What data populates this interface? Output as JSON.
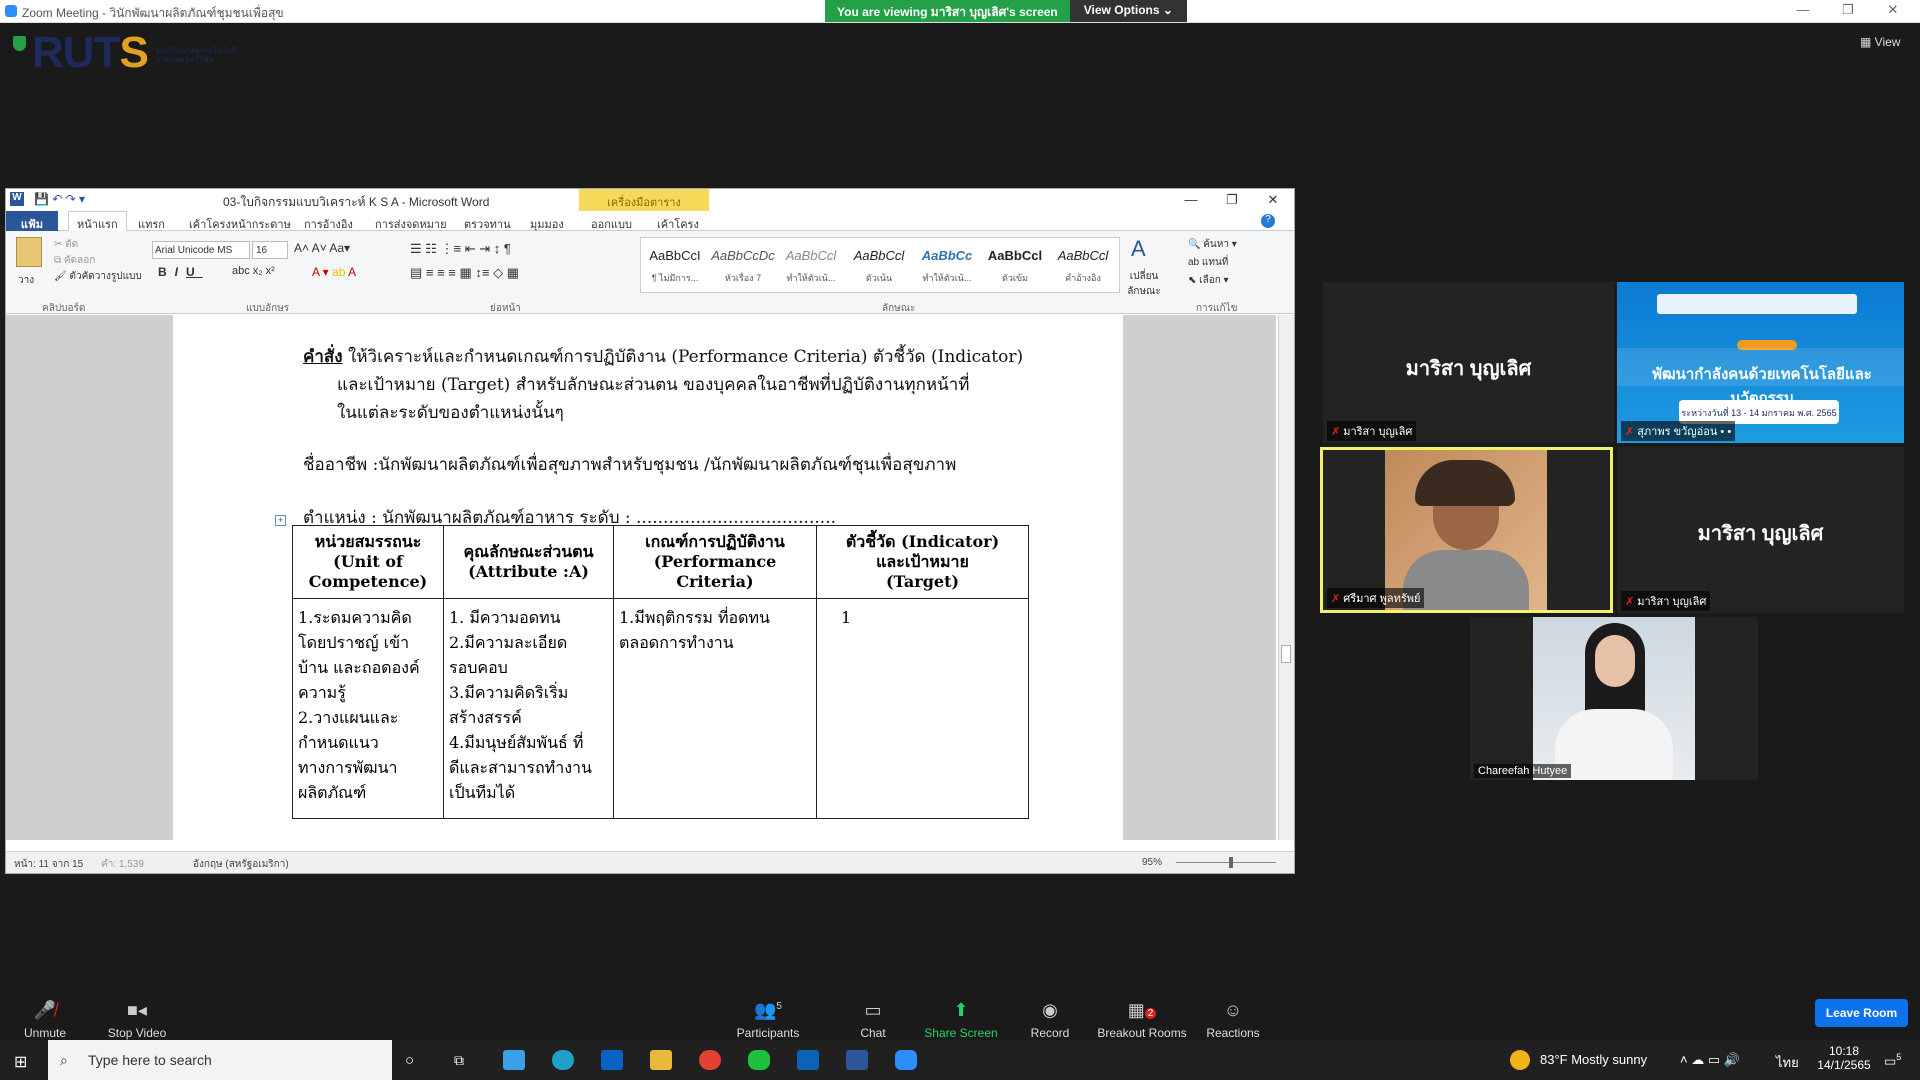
{
  "zoom": {
    "window_title": "Zoom Meeting - วินักพัฒนาผลิตภัณฑ์ชุมชนเพื่อสุข",
    "viewing_banner": "You are viewing มาริสา บุญเลิศ's screen",
    "view_options": "View Options ⌄",
    "view_label": "View",
    "logo_text": "RUTS",
    "controls": {
      "unmute": "Unmute",
      "stop_video": "Stop Video",
      "participants": "Participants",
      "participants_count": "5",
      "chat": "Chat",
      "share_screen": "Share Screen",
      "record": "Record",
      "breakout_rooms": "Breakout Rooms",
      "breakout_badge": "2",
      "reactions": "Reactions",
      "leave_room": "Leave Room"
    },
    "participants": [
      {
        "name": "มาริสา บุญเลิศ",
        "label": "มาริสา บุญเลิศ"
      },
      {
        "name": "",
        "label": "สุภาพร ขวัญอ่อน • •"
      },
      {
        "name": "",
        "label": "ศรีมาศ พูลทรัพย์"
      },
      {
        "name": "มาริสา บุญเลิศ",
        "label": "มาริสา บุญเลิศ"
      },
      {
        "name": "",
        "label": "Chareefah Hutyee"
      }
    ],
    "poster_title": "พัฒนากำลังคนด้วยเทคโนโลยีและนวัตกรรม",
    "poster_date": "ระหว่างวันที่ 13 - 14 มกราคม พ.ศ. 2565"
  },
  "word": {
    "title": "03-ใบกิจกรรมแบบวิเคราะห์ K S A  -  Microsoft Word",
    "contextual_tab": "เครื่องมือตาราง",
    "tabs": [
      "แฟ้ม",
      "หน้าแรก",
      "แทรก",
      "เค้าโครงหน้ากระดาษ",
      "การอ้างอิง",
      "การส่งจดหมาย",
      "ตรวจทาน",
      "มุมมอง",
      "ออกแบบ",
      "เค้าโครง"
    ],
    "font_name": "Arial Unicode MS",
    "font_size": "16",
    "clipboard": {
      "paste": "วาง",
      "cut": "ตัด",
      "copy": "คัดลอก",
      "format_painter": "ตัวคัดวางรูปแบบ"
    },
    "groups": [
      "คลิปบอร์ด",
      "แบบอักษร",
      "ย่อหน้า",
      "ลักษณะ",
      "การแก้ไข"
    ],
    "styles": [
      {
        "sample": "AaBbCcI",
        "name": "¶ ไม่มีการ..."
      },
      {
        "sample": "AaBbCcDc",
        "name": "หัวเรื่อง 7"
      },
      {
        "sample": "AaBbCcl",
        "name": "ทำให้ตัวเน้..."
      },
      {
        "sample": "AaBbCcl",
        "name": "ตัวเน้น"
      },
      {
        "sample": "AaBbCc",
        "name": "ทำให้ตัวเน้..."
      },
      {
        "sample": "AaBbCcl",
        "name": "ตัวเข้ม"
      },
      {
        "sample": "AaBbCcl",
        "name": "คำอ้างอิง"
      }
    ],
    "change_styles": "เปลี่ยน ลักษณะ",
    "editing": {
      "find": "ค้นหา",
      "replace": "แทนที่",
      "select": "เลือก"
    },
    "status": {
      "page": "หน้า: 11 จาก 15",
      "words": "คำ: 1,539",
      "language": "อังกฤษ (สหรัฐอเมริกา)",
      "zoom": "95%"
    },
    "doc": {
      "instruction_label": "คำสั่ง",
      "instruction_1": " ให้วิเคราะห์และกำหนดเกณฑ์การปฏิบัติงาน  (Performance Criteria) ตัวชี้วัด  (Indicator)",
      "instruction_2": "และเป้าหมาย (Target) สำหรับลักษณะส่วนตน ของบุคคลในอาชีพที่ปฏิบัติงานทุกหน้าที่",
      "instruction_3": "ในแต่ละระดับของตำแหน่งนั้นๆ",
      "occupation": "ชื่ออาชีพ :นักพัฒนาผลิตภัณฑ์เพื่อสุขภาพสำหรับชุมชน /นักพัฒนาผลิตภัณฑ์ชุนเพื่อสุขภาพ",
      "position": "ตำแหน่ง : นักพัฒนาผลิตภัณฑ์อาหาร     ระดับ : .....................................",
      "table": {
        "headers": [
          [
            "หน่วยสมรรถนะ",
            "(Unit of",
            "Competence)"
          ],
          [
            "คุณลักษณะส่วนตน",
            "(Attribute  :A)"
          ],
          [
            "เกณฑ์การปฏิบัติงาน",
            "(Performance  Criteria)"
          ],
          [
            "ตัวชี้วัด (Indicator)",
            "และเป้าหมาย",
            "(Target)"
          ]
        ],
        "col1": [
          "1.ระดมความคิด",
          "โดยปราชญ์ เข้า",
          "บ้าน และถอดองค์",
          "ความรู้",
          "2.วางแผนและ",
          "กำหนดแนว",
          "ทางการพัฒนา",
          "ผลิตภัณฑ์"
        ],
        "col2": [
          "1. มีความอดทน",
          "2.มีความละเอียด",
          "รอบคอบ",
          "3.มีความคิดริเริ่ม",
          "สร้างสรรค์",
          "4.มีมนุษย์สัมพันธ์ ที่",
          "ดีและสามารถทำงาน",
          "เป็นทีมได้"
        ],
        "col3": [
          "1.มีพฤติกรรม ที่อดทน",
          "ตลอดการทำงาน"
        ],
        "col4": [
          "1"
        ]
      }
    }
  },
  "taskbar": {
    "search_placeholder": "Type here to search",
    "weather": "83°F  Mostly sunny",
    "lang": "ไทย",
    "time": "10:18",
    "date": "14/1/2565",
    "notif": "5"
  }
}
